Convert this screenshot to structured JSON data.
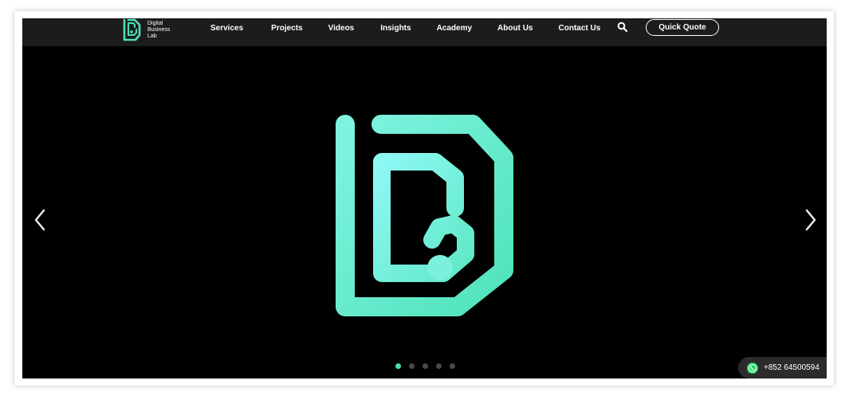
{
  "brand": {
    "name_lines": [
      "Digital",
      "Business",
      "Lab"
    ],
    "logo_icon": "dbl-logo-icon",
    "accent_color": "#4de0b7"
  },
  "nav": {
    "items": [
      {
        "label": "Services"
      },
      {
        "label": "Projects"
      },
      {
        "label": "Videos"
      },
      {
        "label": "Insights"
      },
      {
        "label": "Academy"
      },
      {
        "label": "About Us"
      },
      {
        "label": "Contact Us"
      }
    ],
    "search_icon": "search-icon",
    "quote_button": "Quick Quote"
  },
  "hero": {
    "logo_icon": "dbl-hero-logo",
    "prev_icon": "chevron-left-icon",
    "next_icon": "chevron-right-icon",
    "slides_total": 5,
    "active_slide": 1
  },
  "whatsapp": {
    "icon": "whatsapp-icon",
    "phone": "+852 64500594",
    "color": "#25d366"
  }
}
